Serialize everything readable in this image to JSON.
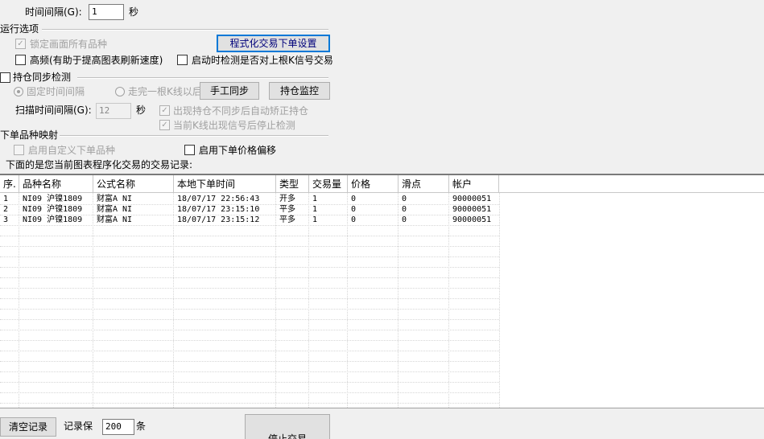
{
  "interval": {
    "label": "时间间隔(G):",
    "value": "1",
    "unit": "秒"
  },
  "run_options": {
    "title": "运行选项",
    "lock_all_products": "锁定画面所有品种",
    "trade_settings_button": "程式化交易下单设置",
    "high_freq": "高频(有助于提高图表刷新速度)",
    "check_last_kline": "启动时检测是否对上根K信号交易"
  },
  "sync": {
    "title": "持仓同步检测",
    "fixed_interval": "固定时间间隔",
    "after_kline": "走完一根K线以后",
    "manual_sync_button": "手工同步",
    "monitor_button": "持仓监控",
    "scan_label": "扫描时间间隔(G):",
    "scan_value": "12",
    "scan_unit": "秒",
    "auto_correct": "出现持仓不同步后自动矫正持仓",
    "stop_on_signal": "当前K线出现信号后停止检测"
  },
  "mapping": {
    "title": "下单品种映射",
    "custom_product": "启用自定义下单品种",
    "price_offset": "启用下单价格偏移"
  },
  "records_caption": "下面的是您当前图表程序化交易的交易记录:",
  "table": {
    "headers": [
      "序.",
      "品种名称",
      "公式名称",
      "本地下单时间",
      "类型",
      "交易量",
      "价格",
      "滑点",
      "帐户"
    ],
    "rows": [
      [
        "1",
        "NI09 沪镍1809",
        "财富A NI",
        "18/07/17 22:56:43",
        "开多",
        "1",
        "0",
        "0",
        "90000051"
      ],
      [
        "2",
        "NI09 沪镍1809",
        "财富A NI",
        "18/07/17 23:15:10",
        "平多",
        "1",
        "0",
        "0",
        "90000051"
      ],
      [
        "3",
        "NI09 沪镍1809",
        "财富A NI",
        "18/07/17 23:15:12",
        "平多",
        "1",
        "0",
        "0",
        "90000051"
      ]
    ]
  },
  "bottom": {
    "clear_button": "清空记录",
    "keep_label": "记录保",
    "keep_value": "200",
    "keep_unit": "条",
    "stop_button": "停止交易"
  }
}
